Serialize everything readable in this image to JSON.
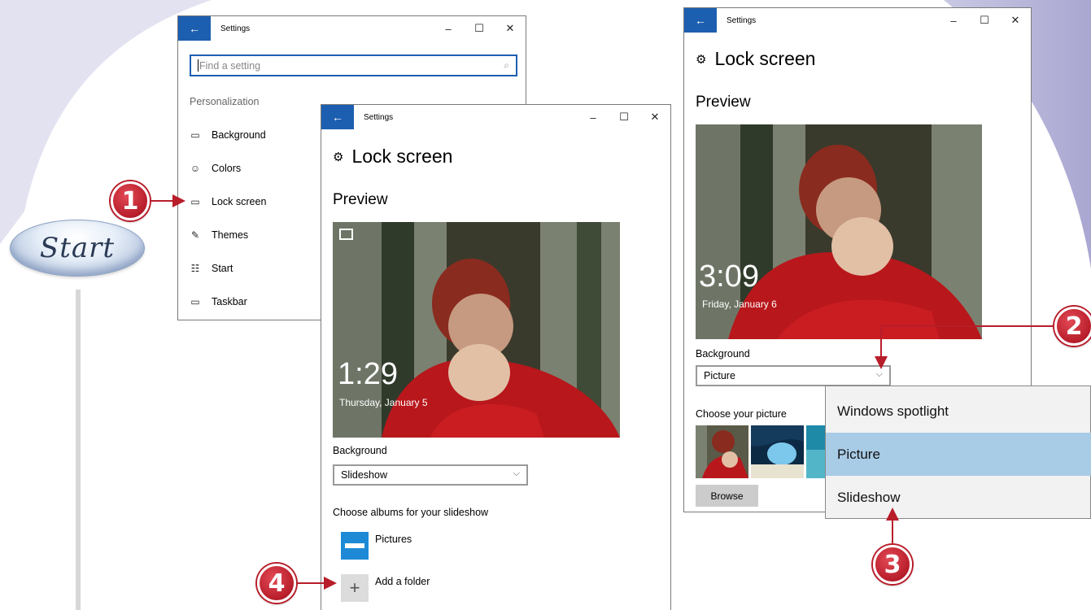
{
  "start_label": "Start",
  "window1": {
    "title": "Settings",
    "back_glyph": "←",
    "minimize_glyph": "–",
    "maximize_glyph": "☐",
    "close_glyph": "✕",
    "search_placeholder": "Find a setting",
    "section": "Personalization",
    "nav": [
      {
        "label": "Background",
        "icon": "picture-icon",
        "glyph": "▭"
      },
      {
        "label": "Colors",
        "icon": "palette-icon",
        "glyph": "☺"
      },
      {
        "label": "Lock screen",
        "icon": "lock-screen-icon",
        "glyph": "▭"
      },
      {
        "label": "Themes",
        "icon": "themes-icon",
        "glyph": "✎"
      },
      {
        "label": "Start",
        "icon": "start-icon",
        "glyph": "☷"
      },
      {
        "label": "Taskbar",
        "icon": "taskbar-icon",
        "glyph": "▭"
      }
    ]
  },
  "window2": {
    "title": "Settings",
    "page_title": "Lock screen",
    "preview_label": "Preview",
    "time": "1:29",
    "date": "Thursday, January 5",
    "background_label": "Background",
    "background_value": "Slideshow",
    "albums_label": "Choose albums for your slideshow",
    "album_pictures": "Pictures",
    "add_folder": "Add a folder"
  },
  "window3": {
    "title": "Settings",
    "page_title": "Lock screen",
    "preview_label": "Preview",
    "time": "3:09",
    "date": "Friday, January 6",
    "background_label": "Background",
    "background_value": "Picture",
    "choose_picture_label": "Choose your picture",
    "browse_label": "Browse"
  },
  "flyout": {
    "options": [
      "Windows spotlight",
      "Picture",
      "Slideshow"
    ],
    "selected": "Picture"
  },
  "callouts": [
    "1",
    "2",
    "3",
    "4"
  ],
  "colors": {
    "accent": "#1c5fb0",
    "callout_red": "#b81d2a",
    "selected_option": "#a8cbe6"
  }
}
